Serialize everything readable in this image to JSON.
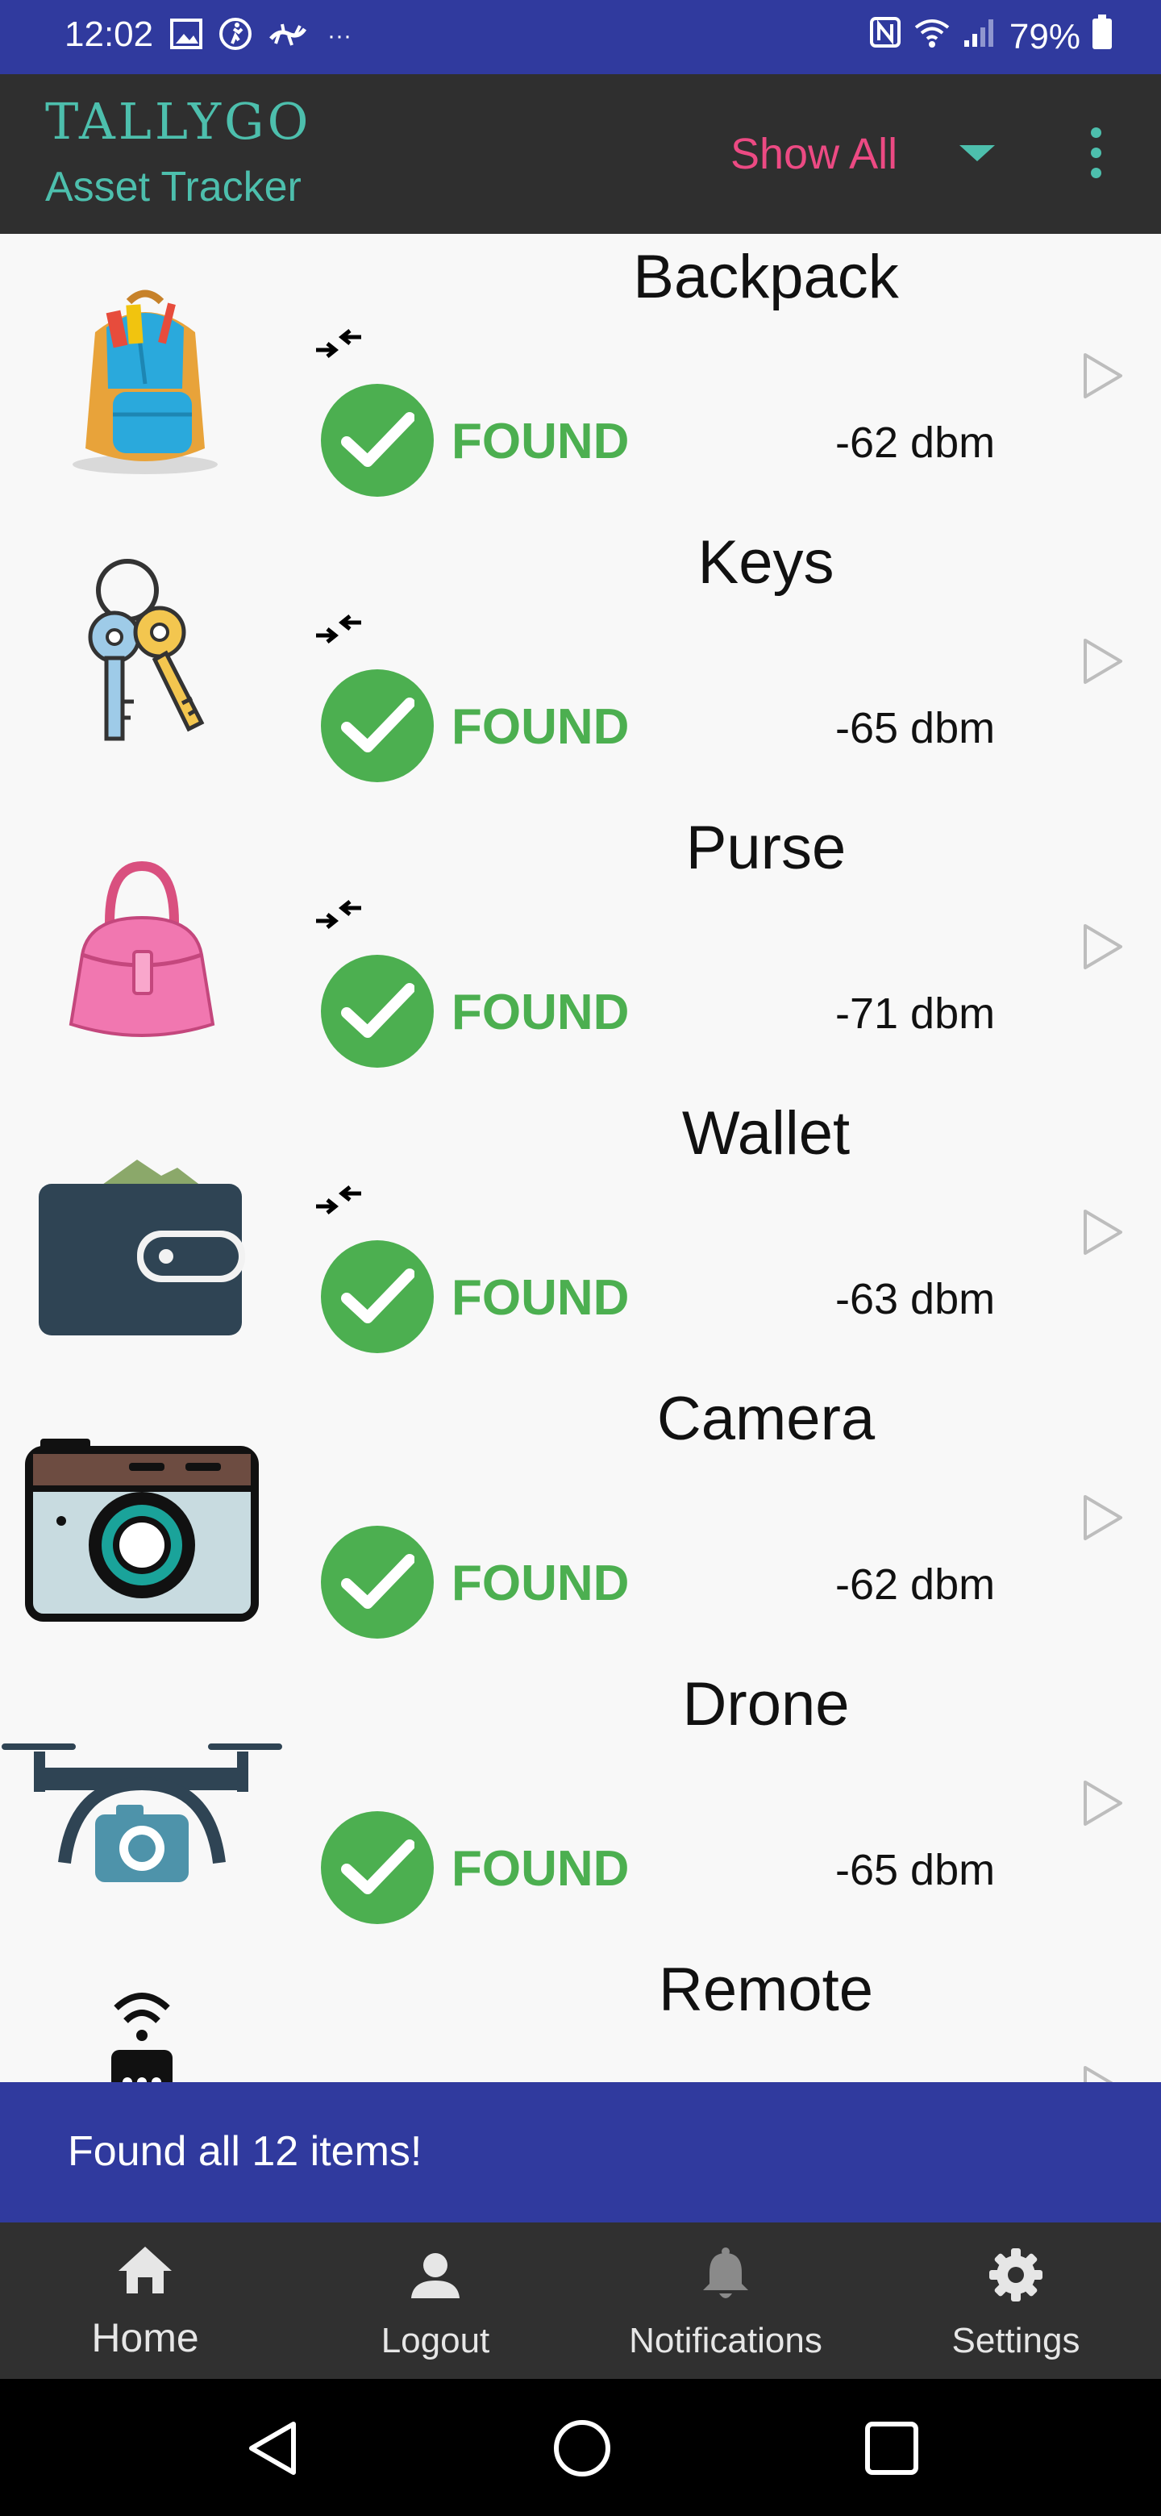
{
  "status_bar": {
    "time": "12:02",
    "battery": "79%"
  },
  "app_bar": {
    "brand": "TALLYGO",
    "subtitle": "Asset Tracker",
    "filter_value": "Show All"
  },
  "items": [
    {
      "name": "Backpack",
      "status": "FOUND",
      "signal": "-62 dbm",
      "icon": "backpack-icon",
      "nearby": true
    },
    {
      "name": "Keys",
      "status": "FOUND",
      "signal": "-65 dbm",
      "icon": "keys-icon",
      "nearby": true
    },
    {
      "name": "Purse",
      "status": "FOUND",
      "signal": "-71 dbm",
      "icon": "purse-icon",
      "nearby": true
    },
    {
      "name": "Wallet",
      "status": "FOUND",
      "signal": "-63 dbm",
      "icon": "wallet-icon",
      "nearby": true
    },
    {
      "name": "Camera",
      "status": "FOUND",
      "signal": "-62 dbm",
      "icon": "camera-icon",
      "nearby": false
    },
    {
      "name": "Drone",
      "status": "FOUND",
      "signal": "-65 dbm",
      "icon": "drone-icon",
      "nearby": false
    },
    {
      "name": "Remote",
      "status": "",
      "signal": "",
      "icon": "remote-icon",
      "nearby": false
    }
  ],
  "snackbar": {
    "message": "Found all 12 items!"
  },
  "bottom_nav": {
    "home": "Home",
    "logout": "Logout",
    "notifications": "Notifications",
    "settings": "Settings"
  },
  "colors": {
    "primary": "#303a9e",
    "accent_teal": "#4dbfad",
    "accent_pink": "#ec4a83",
    "found_green": "#4caf50",
    "appbar": "#2f2f2f"
  }
}
